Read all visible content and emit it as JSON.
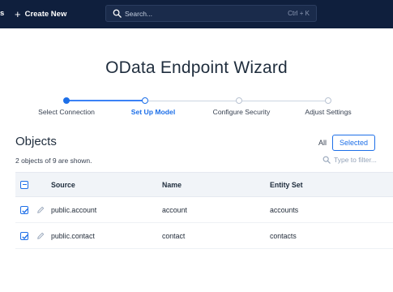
{
  "topbar": {
    "nav_partial": "s",
    "create_new_label": "Create New",
    "search_placeholder": "Search...",
    "search_shortcut": "Ctrl + K"
  },
  "page": {
    "title": "OData Endpoint Wizard"
  },
  "stepper": {
    "steps": [
      {
        "label": "Select Connection",
        "state": "done"
      },
      {
        "label": "Set Up Model",
        "state": "current"
      },
      {
        "label": "Configure Security",
        "state": "pending"
      },
      {
        "label": "Adjust Settings",
        "state": "pending"
      }
    ],
    "accent": "#1d6fe8"
  },
  "objects": {
    "title": "Objects",
    "count_text": "2 objects of 9 are shown.",
    "toggle_all": "All",
    "toggle_selected": "Selected",
    "filter_placeholder": "Type to filter..."
  },
  "table": {
    "columns": [
      "Source",
      "Name",
      "Entity Set"
    ],
    "rows": [
      {
        "source": "public.account",
        "name": "account",
        "entity_set": "accounts",
        "checked": true
      },
      {
        "source": "public.contact",
        "name": "contact",
        "entity_set": "contacts",
        "checked": true
      }
    ]
  },
  "colors": {
    "topbar_bg": "#0f1f3d",
    "accent": "#1d6fe8"
  }
}
